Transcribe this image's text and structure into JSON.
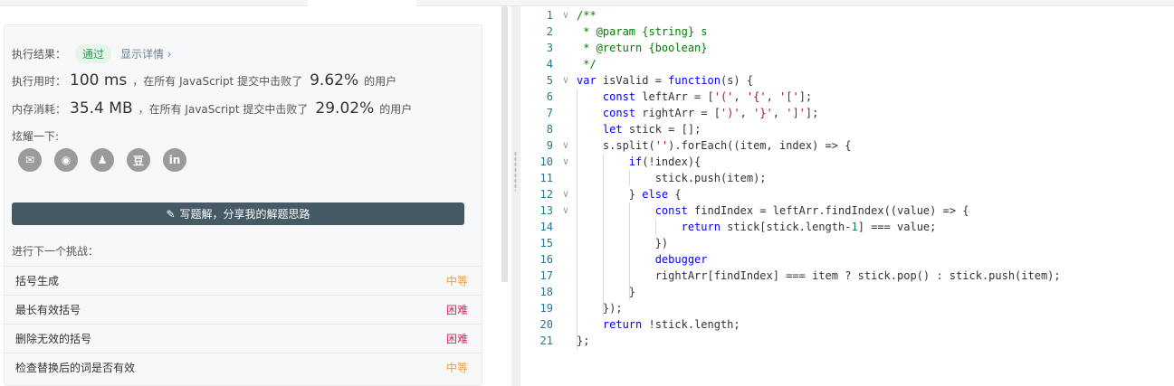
{
  "result": {
    "label": "执行结果：",
    "status": "通过",
    "details_link": "显示详情 ›"
  },
  "runtime": {
    "label": "执行用时：",
    "value": "100 ms",
    "beat_text": "，在所有 JavaScript 提交中击败了",
    "percent": "9.62%",
    "suffix": "的用户"
  },
  "memory": {
    "label": "内存消耗：",
    "value": "35.4 MB",
    "beat_text": "，在所有 JavaScript 提交中击败了",
    "percent": "29.02%",
    "suffix": "的用户"
  },
  "share": {
    "label": "炫耀一下:",
    "icons": [
      "wechat-icon",
      "weibo-icon",
      "qq-icon",
      "douban-icon",
      "linkedin-icon"
    ],
    "glyphs": [
      "✉",
      "◉",
      "♟",
      "豆",
      "in"
    ]
  },
  "write_solution_label": "写题解，分享我的解题思路",
  "next_challenge": {
    "header": "进行下一个挑战：",
    "items": [
      {
        "title": "括号生成",
        "difficulty": "中等",
        "level": "medium"
      },
      {
        "title": "最长有效括号",
        "difficulty": "困难",
        "level": "hard"
      },
      {
        "title": "删除无效的括号",
        "difficulty": "困难",
        "level": "hard"
      },
      {
        "title": "检查替换后的词是否有效",
        "difficulty": "中等",
        "level": "medium"
      }
    ]
  },
  "code_lines": [
    "/**",
    " * @param {string} s",
    " * @return {boolean}",
    " */",
    "var isValid = function(s) {",
    "    const leftArr = ['(', '{', '['];",
    "    const rightArr = [')', '}', ']'];",
    "    let stick = [];",
    "    s.split('').forEach((item, index) => {",
    "        if(!index){",
    "            stick.push(item);",
    "        } else {",
    "            const findIndex = leftArr.findIndex((value) => {",
    "                return stick[stick.length-1] === value;",
    "            })",
    "            debugger",
    "            rightArr[findIndex] === item ? stick.pop() : stick.push(item);",
    "        }",
    "    });",
    "    return !stick.length;",
    "};"
  ],
  "line_numbers": [
    "1",
    "2",
    "3",
    "4",
    "5",
    "6",
    "7",
    "8",
    "9",
    "10",
    "11",
    "12",
    "13",
    "14",
    "15",
    "16",
    "17",
    "18",
    "19",
    "20",
    "21"
  ],
  "fold_markers": [
    "∨",
    "",
    "",
    "",
    "∨",
    "",
    "",
    "",
    "∨",
    "∨",
    "",
    "∨",
    "∨",
    "",
    "",
    "",
    "",
    "",
    "",
    "",
    ""
  ]
}
